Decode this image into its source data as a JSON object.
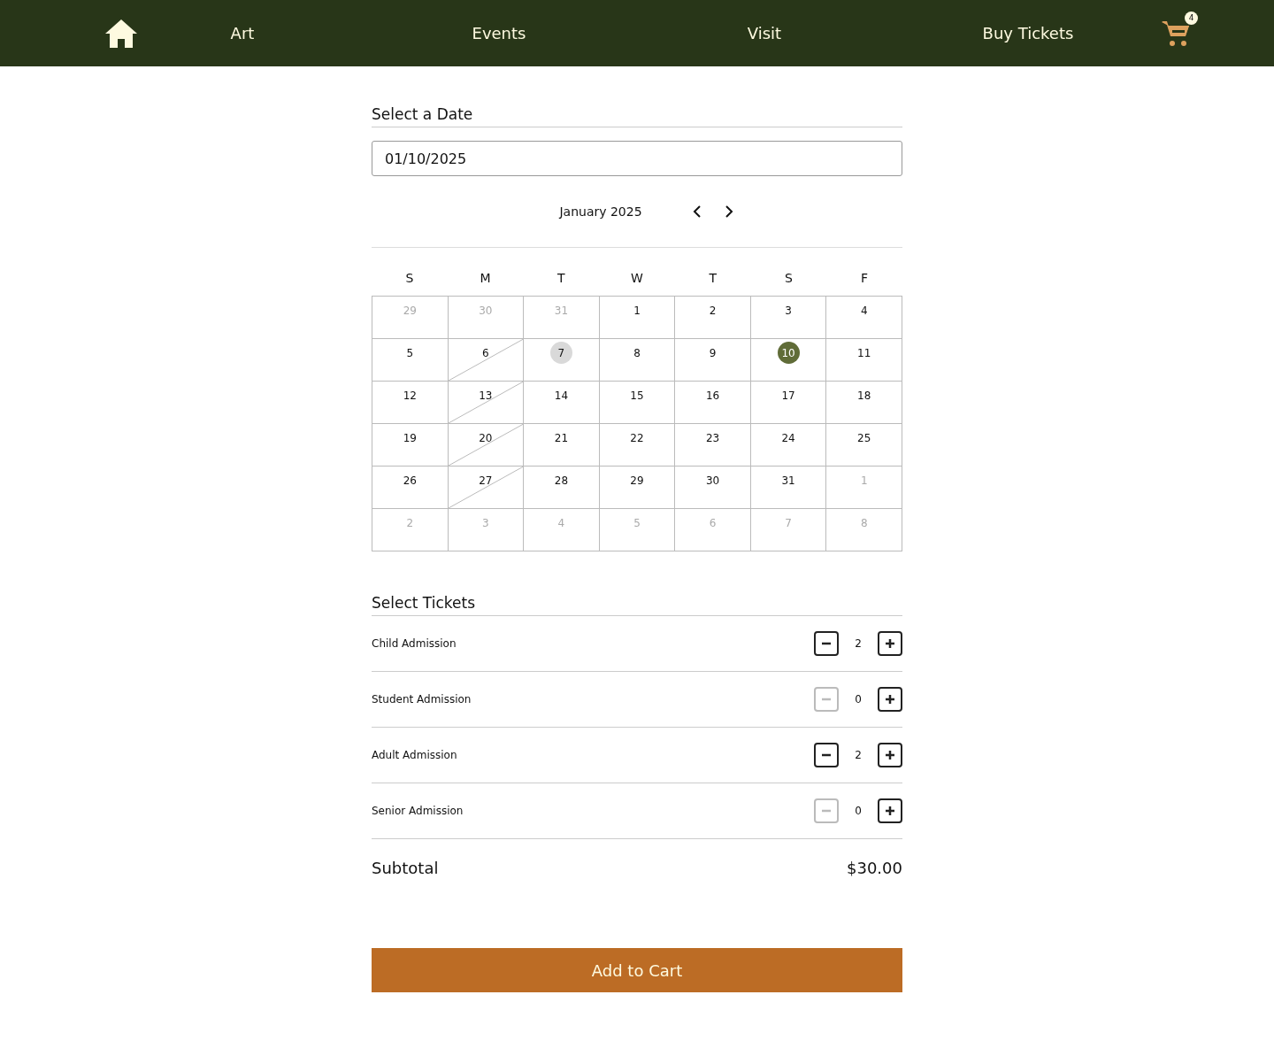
{
  "nav": {
    "items": [
      "Art",
      "Events",
      "Visit",
      "Buy Tickets"
    ],
    "cart_count": "4"
  },
  "date_section": {
    "title": "Select a Date",
    "value": "01/10/2025"
  },
  "calendar": {
    "month": "January 2025",
    "weekdays": [
      "S",
      "M",
      "T",
      "W",
      "T",
      "S",
      "F"
    ],
    "days": [
      {
        "label": "29",
        "outside": true,
        "unavailable": false,
        "today": false,
        "selected": false
      },
      {
        "label": "30",
        "outside": true,
        "unavailable": false,
        "today": false,
        "selected": false
      },
      {
        "label": "31",
        "outside": true,
        "unavailable": false,
        "today": false,
        "selected": false
      },
      {
        "label": "1",
        "outside": false,
        "unavailable": false,
        "today": false,
        "selected": false
      },
      {
        "label": "2",
        "outside": false,
        "unavailable": false,
        "today": false,
        "selected": false
      },
      {
        "label": "3",
        "outside": false,
        "unavailable": false,
        "today": false,
        "selected": false
      },
      {
        "label": "4",
        "outside": false,
        "unavailable": false,
        "today": false,
        "selected": false
      },
      {
        "label": "5",
        "outside": false,
        "unavailable": false,
        "today": false,
        "selected": false
      },
      {
        "label": "6",
        "outside": false,
        "unavailable": true,
        "today": false,
        "selected": false
      },
      {
        "label": "7",
        "outside": false,
        "unavailable": false,
        "today": true,
        "selected": false
      },
      {
        "label": "8",
        "outside": false,
        "unavailable": false,
        "today": false,
        "selected": false
      },
      {
        "label": "9",
        "outside": false,
        "unavailable": false,
        "today": false,
        "selected": false
      },
      {
        "label": "10",
        "outside": false,
        "unavailable": false,
        "today": false,
        "selected": true
      },
      {
        "label": "11",
        "outside": false,
        "unavailable": false,
        "today": false,
        "selected": false
      },
      {
        "label": "12",
        "outside": false,
        "unavailable": false,
        "today": false,
        "selected": false
      },
      {
        "label": "13",
        "outside": false,
        "unavailable": true,
        "today": false,
        "selected": false
      },
      {
        "label": "14",
        "outside": false,
        "unavailable": false,
        "today": false,
        "selected": false
      },
      {
        "label": "15",
        "outside": false,
        "unavailable": false,
        "today": false,
        "selected": false
      },
      {
        "label": "16",
        "outside": false,
        "unavailable": false,
        "today": false,
        "selected": false
      },
      {
        "label": "17",
        "outside": false,
        "unavailable": false,
        "today": false,
        "selected": false
      },
      {
        "label": "18",
        "outside": false,
        "unavailable": false,
        "today": false,
        "selected": false
      },
      {
        "label": "19",
        "outside": false,
        "unavailable": false,
        "today": false,
        "selected": false
      },
      {
        "label": "20",
        "outside": false,
        "unavailable": true,
        "today": false,
        "selected": false
      },
      {
        "label": "21",
        "outside": false,
        "unavailable": false,
        "today": false,
        "selected": false
      },
      {
        "label": "22",
        "outside": false,
        "unavailable": false,
        "today": false,
        "selected": false
      },
      {
        "label": "23",
        "outside": false,
        "unavailable": false,
        "today": false,
        "selected": false
      },
      {
        "label": "24",
        "outside": false,
        "unavailable": false,
        "today": false,
        "selected": false
      },
      {
        "label": "25",
        "outside": false,
        "unavailable": false,
        "today": false,
        "selected": false
      },
      {
        "label": "26",
        "outside": false,
        "unavailable": false,
        "today": false,
        "selected": false
      },
      {
        "label": "27",
        "outside": false,
        "unavailable": true,
        "today": false,
        "selected": false
      },
      {
        "label": "28",
        "outside": false,
        "unavailable": false,
        "today": false,
        "selected": false
      },
      {
        "label": "29",
        "outside": false,
        "unavailable": false,
        "today": false,
        "selected": false
      },
      {
        "label": "30",
        "outside": false,
        "unavailable": false,
        "today": false,
        "selected": false
      },
      {
        "label": "31",
        "outside": false,
        "unavailable": false,
        "today": false,
        "selected": false
      },
      {
        "label": "1",
        "outside": true,
        "unavailable": false,
        "today": false,
        "selected": false
      },
      {
        "label": "2",
        "outside": true,
        "unavailable": false,
        "today": false,
        "selected": false
      },
      {
        "label": "3",
        "outside": true,
        "unavailable": false,
        "today": false,
        "selected": false
      },
      {
        "label": "4",
        "outside": true,
        "unavailable": false,
        "today": false,
        "selected": false
      },
      {
        "label": "5",
        "outside": true,
        "unavailable": false,
        "today": false,
        "selected": false
      },
      {
        "label": "6",
        "outside": true,
        "unavailable": false,
        "today": false,
        "selected": false
      },
      {
        "label": "7",
        "outside": true,
        "unavailable": false,
        "today": false,
        "selected": false
      },
      {
        "label": "8",
        "outside": true,
        "unavailable": false,
        "today": false,
        "selected": false
      }
    ]
  },
  "tickets": {
    "title": "Select Tickets",
    "rows": [
      {
        "name": "Child Admission",
        "count": "2",
        "minus_disabled": false
      },
      {
        "name": "Student Admission",
        "count": "0",
        "minus_disabled": true
      },
      {
        "name": "Adult Admission",
        "count": "2",
        "minus_disabled": false
      },
      {
        "name": "Senior Admission",
        "count": "0",
        "minus_disabled": true
      }
    ]
  },
  "subtotal": {
    "label": "Subtotal",
    "amount": "$30.00"
  },
  "add_button": "Add to Cart"
}
